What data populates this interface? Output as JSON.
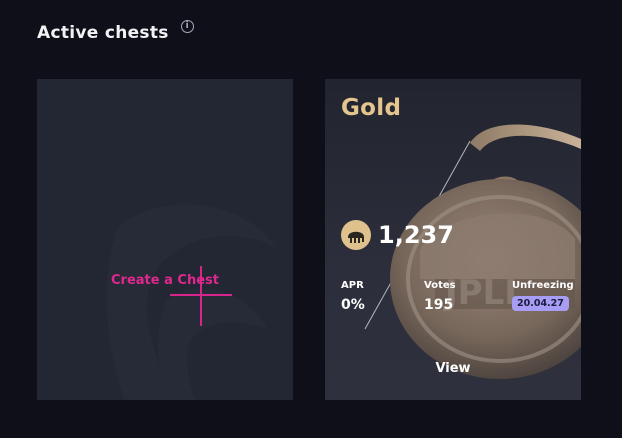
{
  "header": {
    "title": "Active chests",
    "info_icon": "info-icon"
  },
  "create_card": {
    "label": "Create a Chest",
    "icon": "plus-icon",
    "accent": "#d8258e"
  },
  "chest": {
    "name": "Gold",
    "name_color": "#e4c58e",
    "token_icon": "token-coin-icon",
    "amount": "1,237",
    "stats": {
      "apr_label": "APR",
      "apr_value": "0%",
      "votes_label": "Votes",
      "votes_value": "195",
      "unfreezing_label": "Unfreezing",
      "unfreezing_value": "20.04.27"
    },
    "view_label": "View"
  },
  "colors": {
    "background": "#0e0f18",
    "card": "#232733",
    "badge": "#a79df5"
  }
}
